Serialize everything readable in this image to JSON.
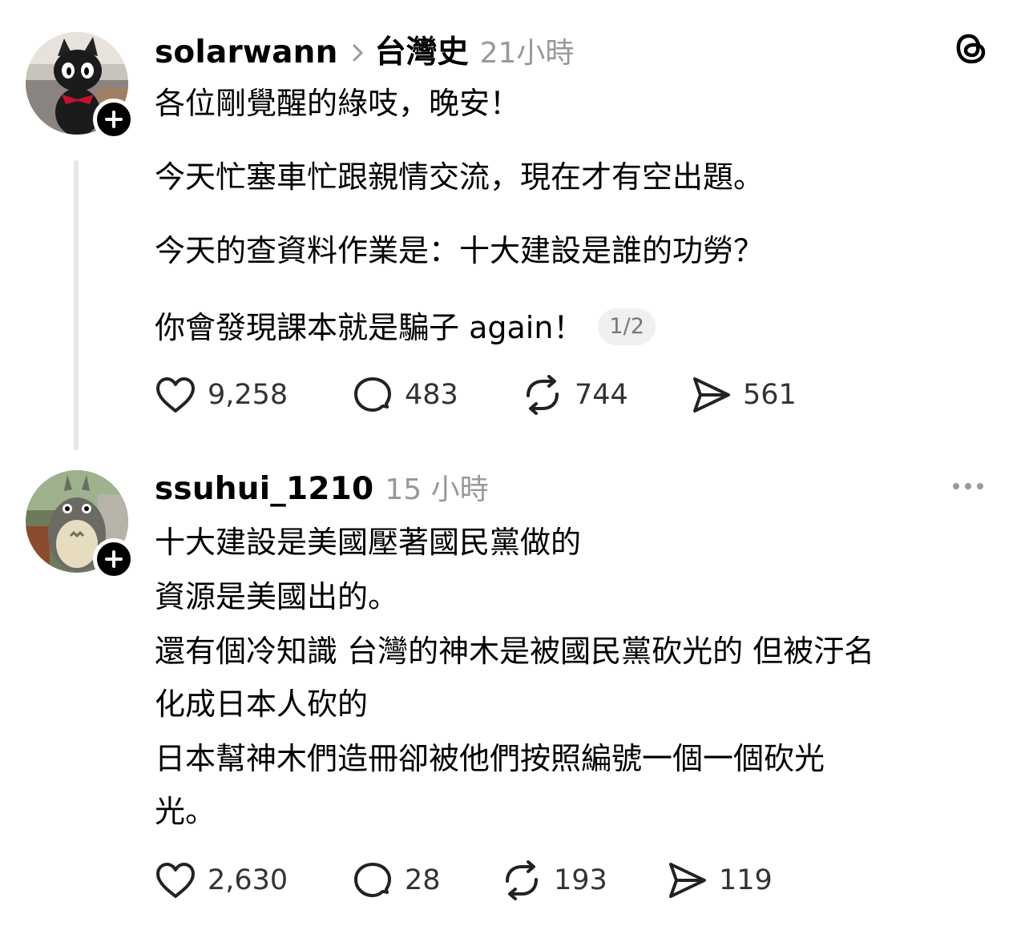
{
  "posts": [
    {
      "username": "solarwann",
      "topic": "台灣史",
      "time": "21小時",
      "paragraphs": [
        "各位剛覺醒的綠吱，晚安！",
        "今天忙塞車忙跟親情交流，現在才有空出題。",
        "今天的查資料作業是：十大建設是誰的功勞？",
        "你會發現課本就是騙子 again！"
      ],
      "page_indicator": "1/2",
      "likes": "9,258",
      "replies": "483",
      "reposts": "744",
      "shares": "561"
    },
    {
      "username": "ssuhui_1210",
      "time": "15 小時",
      "lines": [
        "十大建設是美國壓著國民黨做的",
        "資源是美國出的。",
        "還有個冷知識 台灣的神木是被國民黨砍光的 但被汙名",
        "化成日本人砍的",
        "日本幫神木們造冊卻被他們按照編號一個一個砍光",
        "光。"
      ],
      "likes": "2,630",
      "replies": "28",
      "reposts": "193",
      "shares": "119"
    }
  ],
  "icons": {
    "app_logo": "threads-logo-icon",
    "like": "heart-icon",
    "reply": "comment-icon",
    "repost": "repost-icon",
    "share": "send-icon",
    "more": "more-icon",
    "follow": "plus-icon"
  }
}
